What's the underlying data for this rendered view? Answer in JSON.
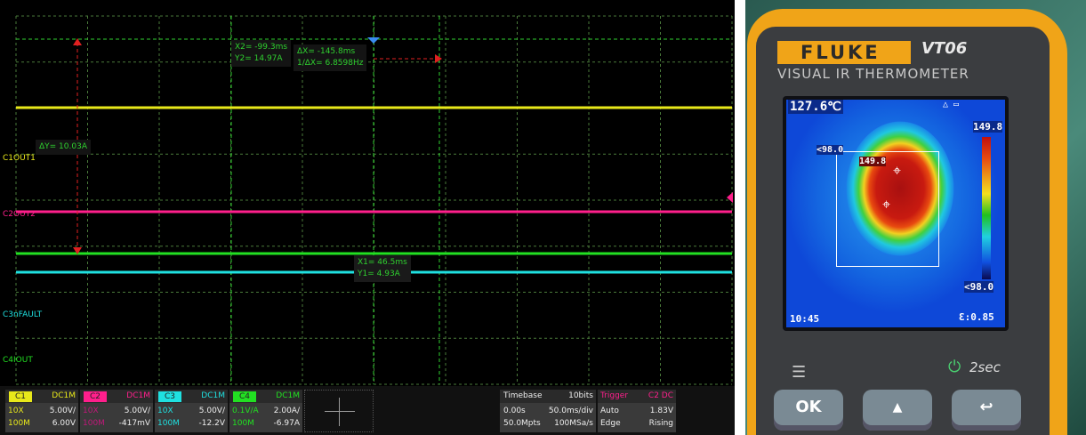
{
  "scope": {
    "colors": {
      "c1": "#e8e81a",
      "c2": "#ff1f8c",
      "c3": "#1fe0e0",
      "c4": "#22e022",
      "cursor": "#2fd02f",
      "delta": "#e02020"
    },
    "channel_labels": [
      {
        "id": "C1",
        "name": "OUT1"
      },
      {
        "id": "C2",
        "name": "OUT2"
      },
      {
        "id": "C3",
        "name": "nFAULT"
      },
      {
        "id": "C4",
        "name": "IOUT"
      }
    ],
    "cursors": {
      "x2": "X2= -99.3ms",
      "y2": "Y2= 14.97A",
      "dx": "ΔX= -145.8ms",
      "inv_dx": "1/ΔX= 6.8598Hz",
      "dy": "ΔY= 10.03A",
      "x1": "X1= 46.5ms",
      "y1": "Y1= 4.93A"
    },
    "channels": [
      {
        "tag": "C1",
        "coupling": "DC1M",
        "probe": "10X",
        "scale": "5.00V/",
        "bw": "100M",
        "offset": "6.00V"
      },
      {
        "tag": "C2",
        "coupling": "DC1M",
        "probe": "10X",
        "scale": "5.00V/",
        "bw": "100M",
        "offset": "-417mV"
      },
      {
        "tag": "C3",
        "coupling": "DC1M",
        "probe": "10X",
        "scale": "5.00V/",
        "bw": "100M",
        "offset": "-12.2V"
      },
      {
        "tag": "C4",
        "coupling": "DC1M",
        "probe": "0.1V/A",
        "scale": "2.00A/",
        "bw": "100M",
        "offset": "-6.97A"
      }
    ],
    "timebase": {
      "label": "Timebase",
      "bits": "10bits",
      "delay": "0.00s",
      "scale": "50.0ms/div",
      "mem": "50.0Mpts",
      "rate": "100MSa/s"
    },
    "trigger": {
      "label": "Trigger",
      "source": "C2 DC",
      "mode": "Auto",
      "level": "1.83V",
      "type": "Edge",
      "slope": "Rising"
    }
  },
  "thermometer": {
    "brand": "FLUKE",
    "model": "VT06",
    "subtitle": "VISUAL IR THERMOMETER",
    "center_temp": "127.6℃",
    "max_scale": "149.8",
    "min_scale": "<98.0",
    "hot_marker": "149.8",
    "cold_marker": "<98.0",
    "time": "10:45",
    "emissivity": "Ɛ:0.85",
    "timer": "2sec",
    "buttons": {
      "ok": "OK",
      "up": "▲",
      "back": "↩"
    }
  }
}
